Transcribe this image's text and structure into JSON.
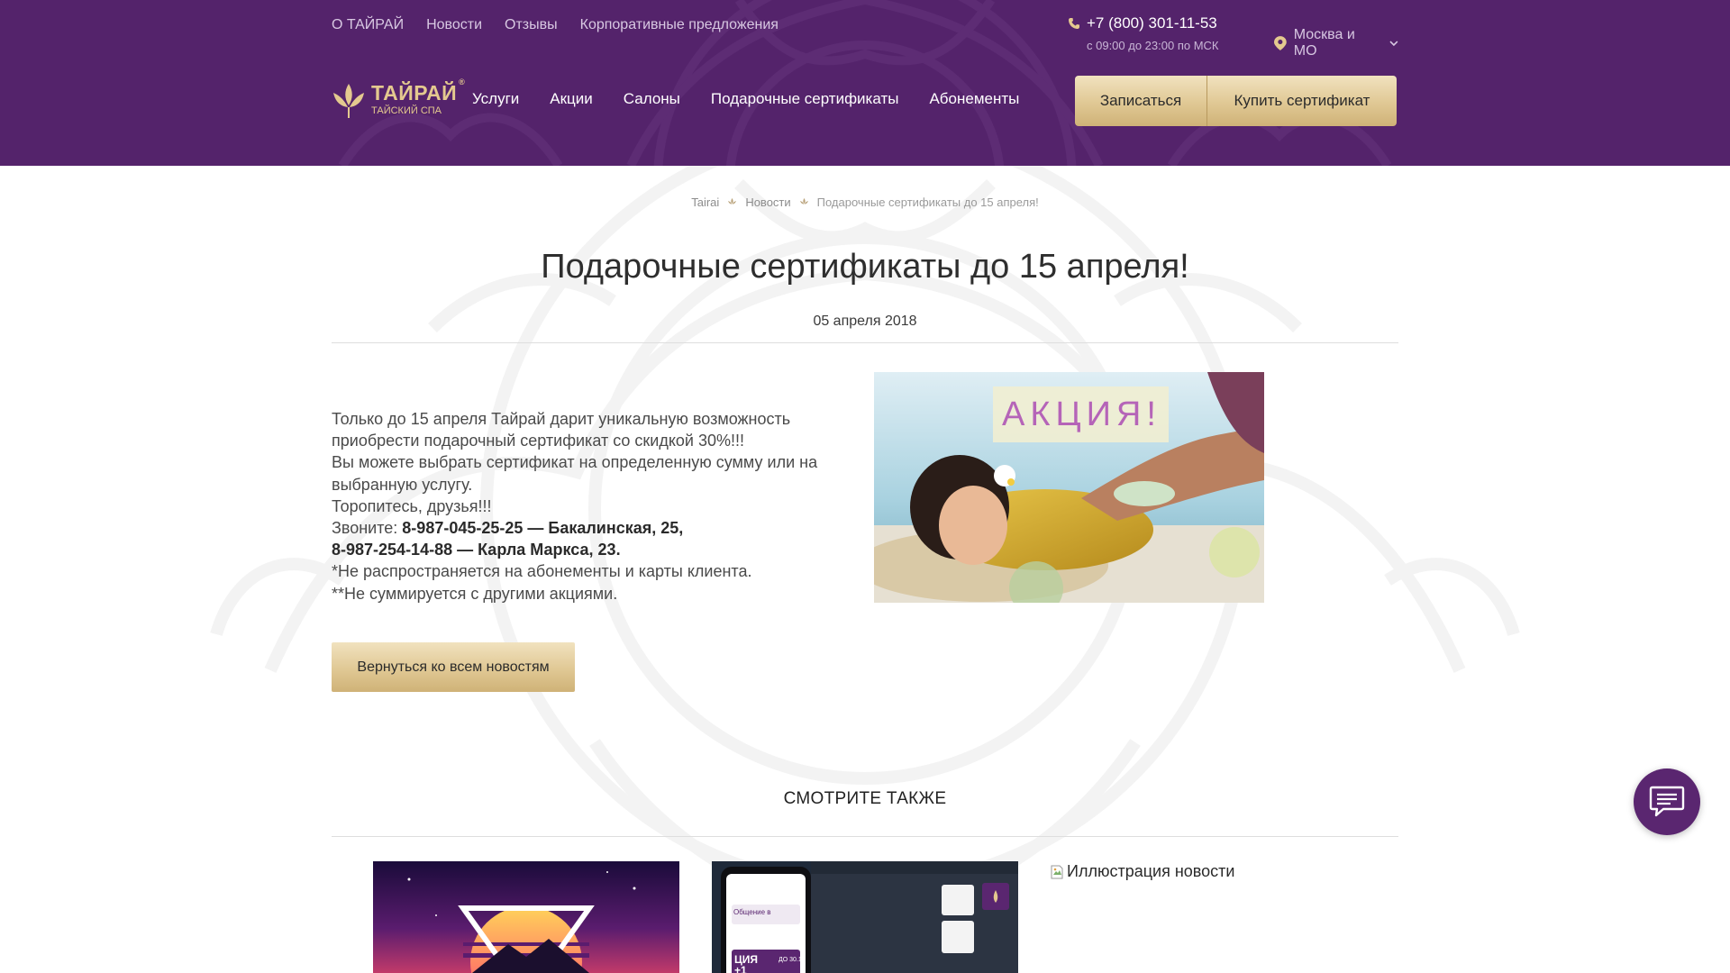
{
  "header": {
    "top_links": [
      "О ТАЙРАЙ",
      "Новости",
      "Отзывы",
      "Корпоративные предложения"
    ],
    "phone": "+7 (800) 301-11-53",
    "hours": "с 09:00 до 23:00 по МСК",
    "region": "Москва и МО",
    "logo": {
      "title": "ТАЙРАЙ",
      "reg": "®",
      "subtitle": "ТАЙСКИЙ СПА"
    },
    "nav": [
      "Услуги",
      "Акции",
      "Салоны",
      "Подарочные сертификаты",
      "Абонементы"
    ],
    "signup_label": "Записаться",
    "buy_cert_label": "Купить сертификат"
  },
  "breadcrumb": [
    "Tairai",
    "Новости",
    "Подарочные сертификаты до 15 апреля!"
  ],
  "article": {
    "title": "Подарочные сертификаты до 15 апреля!",
    "date": "05 апреля 2018",
    "lines": {
      "l1": "Только до 15 апреля Тайрай дарит уникальную возможность приобрести подарочный сертификат со скидкой 30%!!!",
      "l2": "Вы можете выбрать сертификат на определенную сумму или на выбранную услугу.",
      "l3": "Торопитесь, друзья!!!",
      "call_prefix": "Звоните: ",
      "call_1": "8-987-045-25-25 — Бакалинская, 25,",
      "call_2": "8-987-254-14-88 — Карла Маркса, 23.",
      "note_1": "*Не распространяется на абонементы и карты клиента.",
      "note_2": "**Не суммируется с другими акциями."
    },
    "image_caption": "АКЦИЯ!",
    "back_label": "Вернуться ко всем новостям"
  },
  "see_also": {
    "title": "СМОТРИТЕ ТАКЖЕ",
    "card2_texts": {
      "t1": "Общение в",
      "t2": "ЦИЯ",
      "t3": "+1",
      "t4": "ДО 30.11"
    },
    "broken_alt": "Иллюстрация новости"
  },
  "colors": {
    "header_bg": "#54236b",
    "gold": "#e0c894",
    "chat_bg": "#5a2670"
  }
}
